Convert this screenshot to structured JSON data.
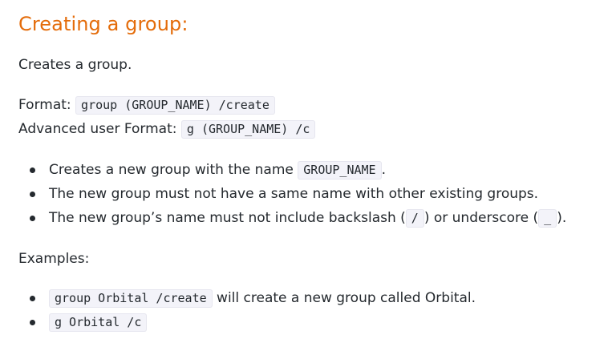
{
  "heading": "Creating a group:",
  "intro": "Creates a group.",
  "format": {
    "label": "Format:",
    "code": "group (GROUP_NAME) /create"
  },
  "advanced_format": {
    "label": "Advanced user Format:",
    "code": "g (GROUP_NAME) /c"
  },
  "notes": [
    {
      "before": "Creates a new group with the name ",
      "code": "GROUP_NAME",
      "after": "."
    },
    {
      "text": "The new group must not have a same name with other existing groups."
    },
    {
      "before": "The new group’s name must not include backslash (",
      "code1": "/",
      "middle": ") or underscore (",
      "code2": "_",
      "after": ")."
    }
  ],
  "examples_label": "Examples:",
  "examples": [
    {
      "code": "group Orbital /create",
      "after": " will create a new group called Orbital."
    },
    {
      "code": "g Orbital /c"
    }
  ]
}
